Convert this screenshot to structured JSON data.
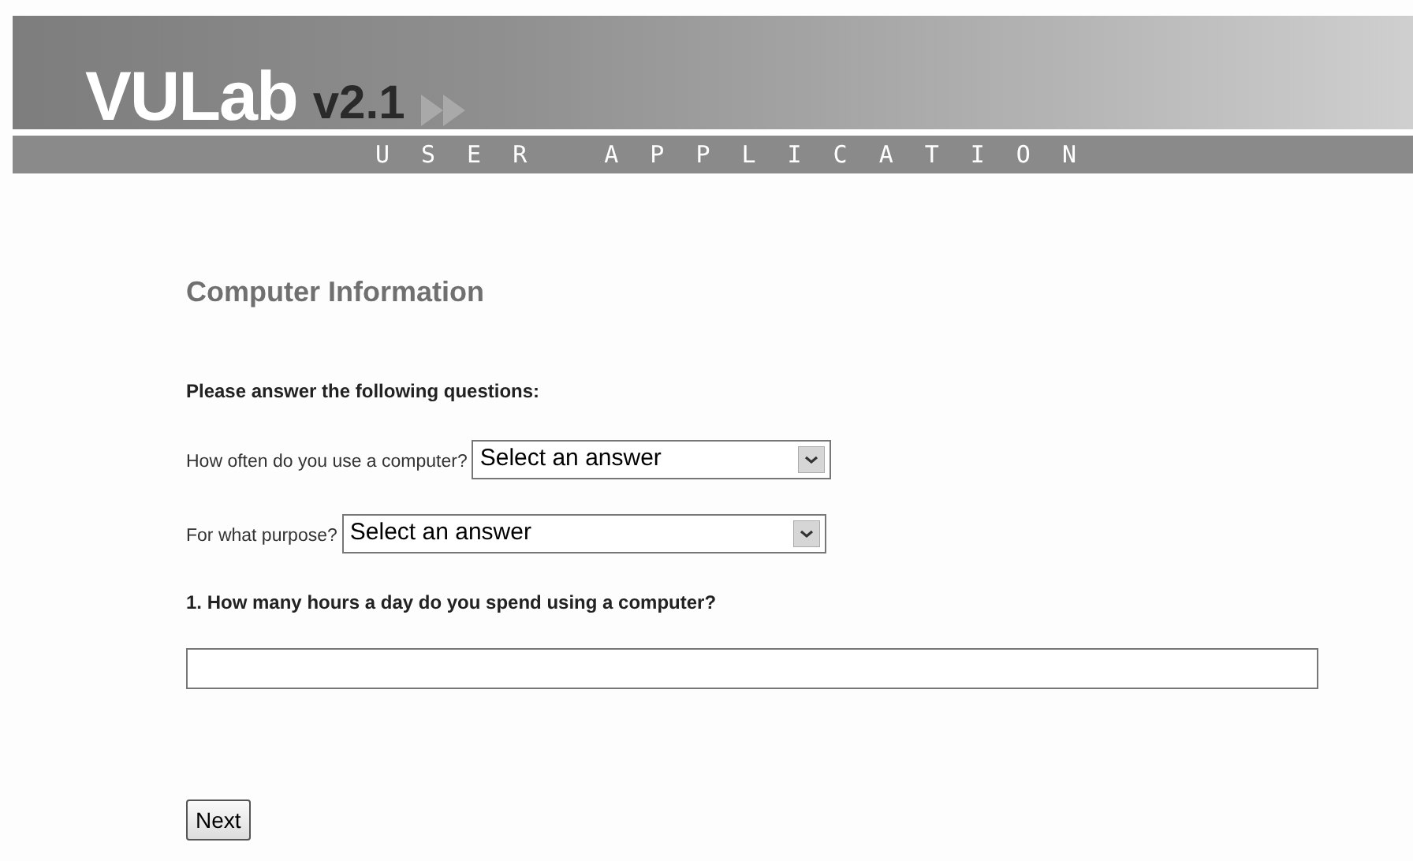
{
  "banner": {
    "logo": "VULab",
    "version": "v2.1",
    "subtitle": "USER APPLICATION"
  },
  "heading": "Computer Information",
  "instructions": "Please answer the following questions:",
  "selects": [
    {
      "label": "How often do you use a computer?",
      "value": "Select an answer"
    },
    {
      "label": "For what purpose?",
      "value": "Select an answer"
    }
  ],
  "question": "1. How many hours a day do you spend using a computer?",
  "next_button": "Next"
}
